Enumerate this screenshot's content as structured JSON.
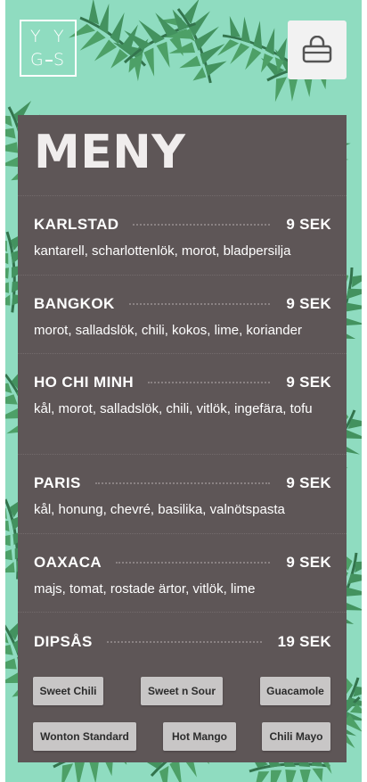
{
  "colors": {
    "background_teal": "#8fdcc0",
    "leaf_green": "#3f8f5a",
    "panel_gray": "#5e5657",
    "sauce_button": "#c8c6c6"
  },
  "header": {
    "logo_letters": [
      "Y",
      "Y",
      "G",
      "S"
    ],
    "cart_icon": "basket-icon"
  },
  "menu": {
    "title": "MENY",
    "items": [
      {
        "name": "KARLSTAD",
        "price": "9 SEK",
        "desc": "kantarell, scharlottenlök, morot, bladpersilja"
      },
      {
        "name": "BANGKOK",
        "price": "9 SEK",
        "desc": "morot, salladslök, chili, kokos, lime, koriander"
      },
      {
        "name": "HO CHI MINH",
        "price": "9 SEK",
        "desc": "kål, morot, salladslök, chili, vitlök, ingefära, tofu"
      },
      {
        "name": "PARIS",
        "price": "9 SEK",
        "desc": "kål, honung, chevré, basilika, valnötspasta"
      },
      {
        "name": "OAXACA",
        "price": "9 SEK",
        "desc": "majs, tomat, rostade ärtor, vitlök, lime"
      },
      {
        "name": "DIPSÅS",
        "price": "19 SEK"
      }
    ],
    "sauces": [
      "Sweet Chili",
      "Sweet n Sour",
      "Guacamole",
      "Wonton Standard",
      "Hot Mango",
      "Chili Mayo"
    ]
  }
}
